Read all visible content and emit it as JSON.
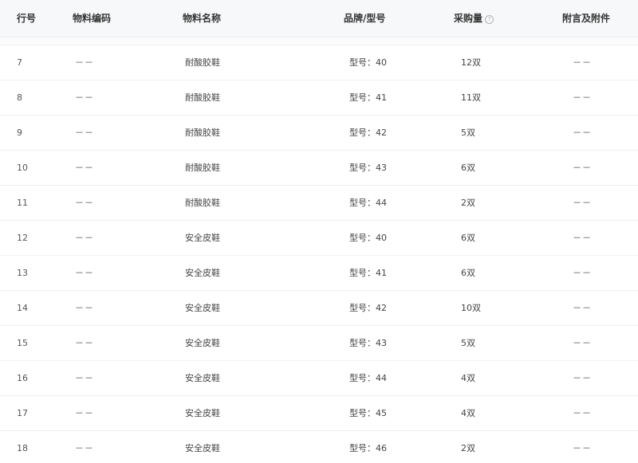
{
  "columns": {
    "line_no": "行号",
    "code": "物料编码",
    "name": "物料名称",
    "brand_model": "品牌/型号",
    "quantity": "采购量",
    "remark": "附言及附件"
  },
  "icons": {
    "quantity_help": "help-circle-icon"
  },
  "rows": [
    {
      "line": "7",
      "code": "－－",
      "name": "耐酸胶鞋",
      "model": "型号：40",
      "qty": "12双",
      "remark": "－－"
    },
    {
      "line": "8",
      "code": "－－",
      "name": "耐酸胶鞋",
      "model": "型号：41",
      "qty": "11双",
      "remark": "－－"
    },
    {
      "line": "9",
      "code": "－－",
      "name": "耐酸胶鞋",
      "model": "型号：42",
      "qty": "5双",
      "remark": "－－"
    },
    {
      "line": "10",
      "code": "－－",
      "name": "耐酸胶鞋",
      "model": "型号：43",
      "qty": "6双",
      "remark": "－－"
    },
    {
      "line": "11",
      "code": "－－",
      "name": "耐酸胶鞋",
      "model": "型号：44",
      "qty": "2双",
      "remark": "－－"
    },
    {
      "line": "12",
      "code": "－－",
      "name": "安全皮鞋",
      "model": "型号：40",
      "qty": "6双",
      "remark": "－－"
    },
    {
      "line": "13",
      "code": "－－",
      "name": "安全皮鞋",
      "model": "型号：41",
      "qty": "6双",
      "remark": "－－"
    },
    {
      "line": "14",
      "code": "－－",
      "name": "安全皮鞋",
      "model": "型号：42",
      "qty": "10双",
      "remark": "－－"
    },
    {
      "line": "15",
      "code": "－－",
      "name": "安全皮鞋",
      "model": "型号：43",
      "qty": "5双",
      "remark": "－－"
    },
    {
      "line": "16",
      "code": "－－",
      "name": "安全皮鞋",
      "model": "型号：44",
      "qty": "4双",
      "remark": "－－"
    },
    {
      "line": "17",
      "code": "－－",
      "name": "安全皮鞋",
      "model": "型号：45",
      "qty": "4双",
      "remark": "－－"
    },
    {
      "line": "18",
      "code": "－－",
      "name": "安全皮鞋",
      "model": "型号：46",
      "qty": "2双",
      "remark": "－－"
    }
  ]
}
